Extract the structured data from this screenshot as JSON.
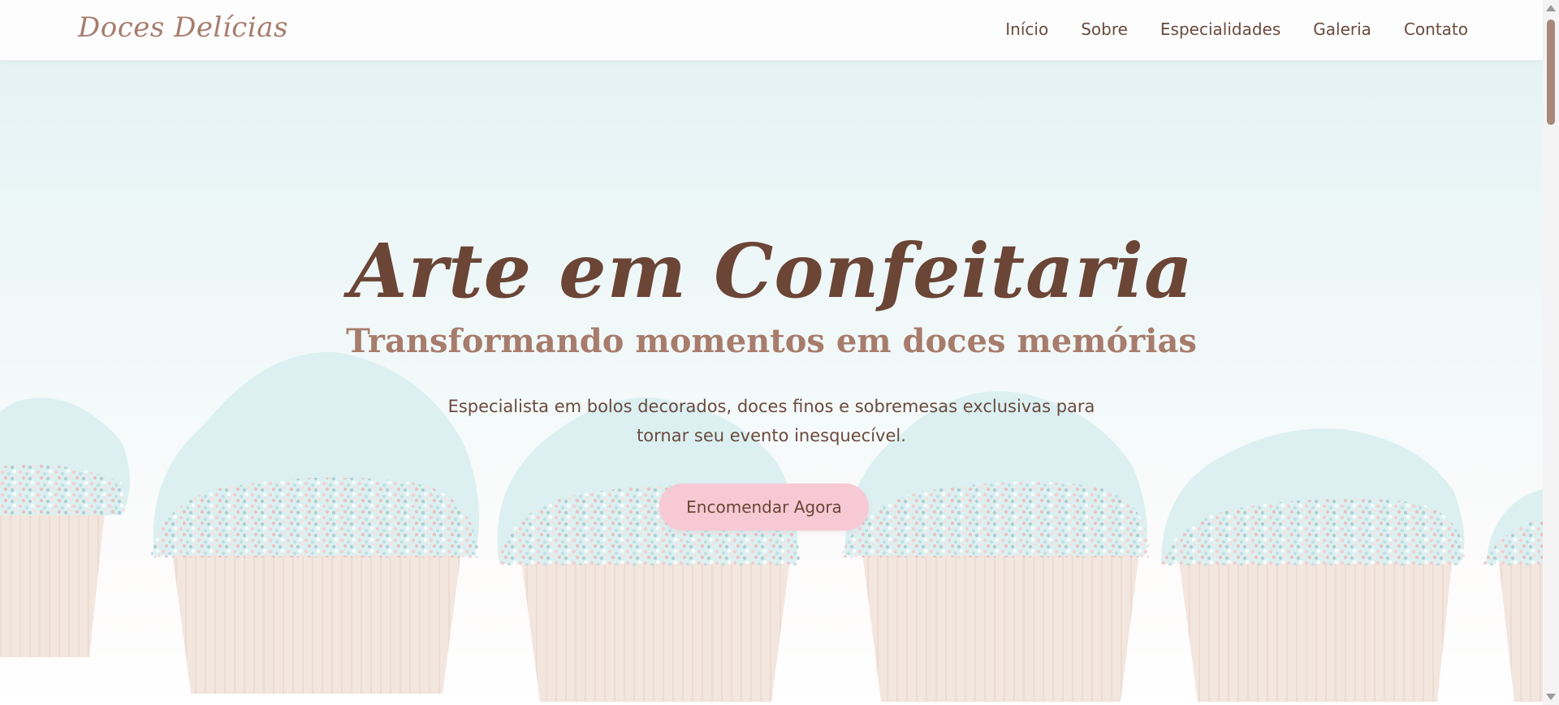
{
  "brand": {
    "logo_text": "Doces Delícias"
  },
  "nav": {
    "items": [
      {
        "label": "Início"
      },
      {
        "label": "Sobre"
      },
      {
        "label": "Especialidades"
      },
      {
        "label": "Galeria"
      },
      {
        "label": "Contato"
      }
    ]
  },
  "hero": {
    "title": "Arte em Confeitaria",
    "subtitle": "Transformando momentos em doces memórias",
    "description": "Especialista em bolos decorados, doces finos e sobremesas exclusivas para tornar seu evento inesquecível.",
    "cta_label": "Encomendar Agora",
    "background_image": "cupcakes-with-sprinkles"
  },
  "colors": {
    "brand_brown": "#6b4536",
    "accent_rose": "#a77c6c",
    "cta_pink": "#f6c9d5",
    "frosting_mint": "#bfe4e6"
  }
}
